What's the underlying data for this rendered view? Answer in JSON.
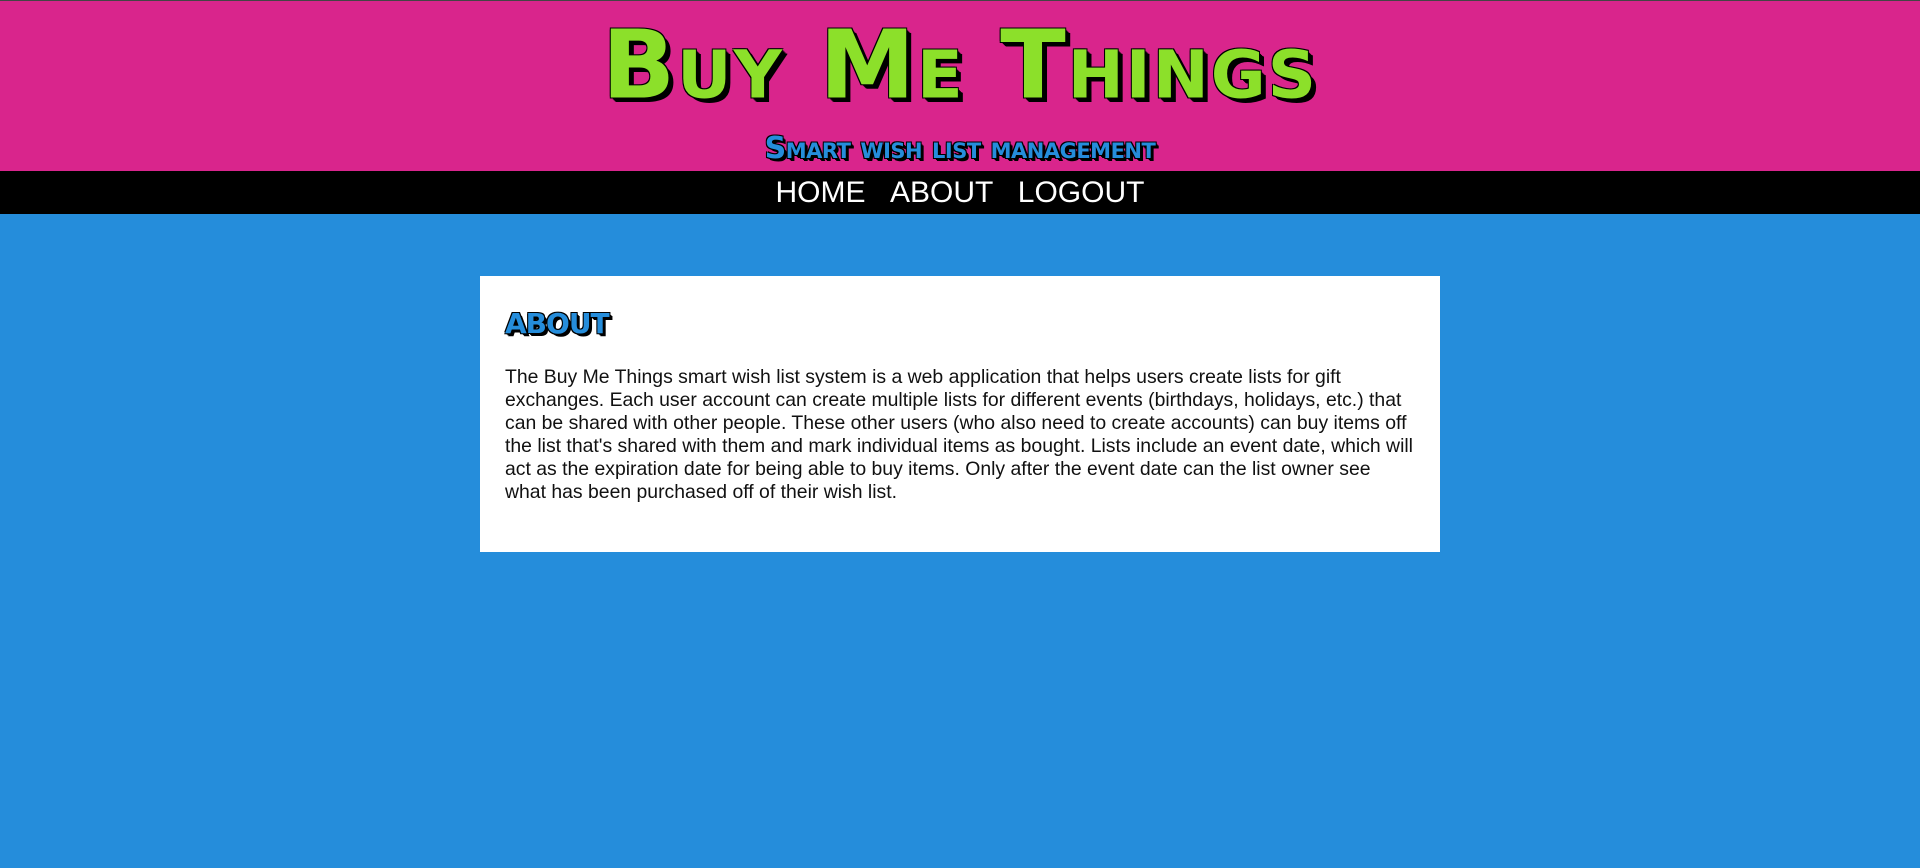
{
  "header": {
    "title": "Buy Me Things",
    "tagline": "Smart wish list management"
  },
  "nav": {
    "items": [
      {
        "label": "HOME"
      },
      {
        "label": "ABOUT"
      },
      {
        "label": "LOGOUT"
      }
    ]
  },
  "about": {
    "heading": "ABOUT",
    "body": "The Buy Me Things smart wish list system is a web application that helps users create lists for gift exchanges. Each user account can create multiple lists for different events (birthdays, holidays, etc.) that can be shared with other people. These other users (who also need to create accounts) can buy items off the list that's shared with them and mark individual items as bought. Lists include an event date, which will act as the expiration date for being able to buy items. Only after the event date can the list owner see what has been purchased off of their wish list."
  },
  "colors": {
    "header_bg": "#d9258c",
    "title": "#8ce02a",
    "page_bg": "#258ddb",
    "nav_bg": "#000000"
  }
}
